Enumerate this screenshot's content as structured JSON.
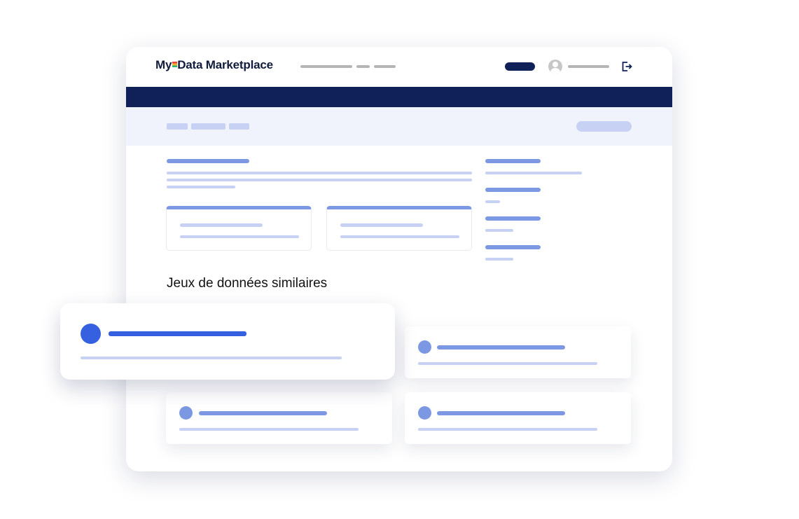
{
  "app": {
    "logo_text_before": "My",
    "logo_text_after": "Data Marketplace"
  },
  "icons": {
    "avatar": "user-avatar-icon",
    "logout": "logout-icon"
  },
  "section": {
    "similar_title": "Jeux de données similaires"
  },
  "colors": {
    "navy": "#10215a",
    "accent_blue": "#3560e0",
    "medium_blue": "#7d98e3",
    "light_blue": "#c6d1f3",
    "band_bg": "#f0f3fc"
  }
}
